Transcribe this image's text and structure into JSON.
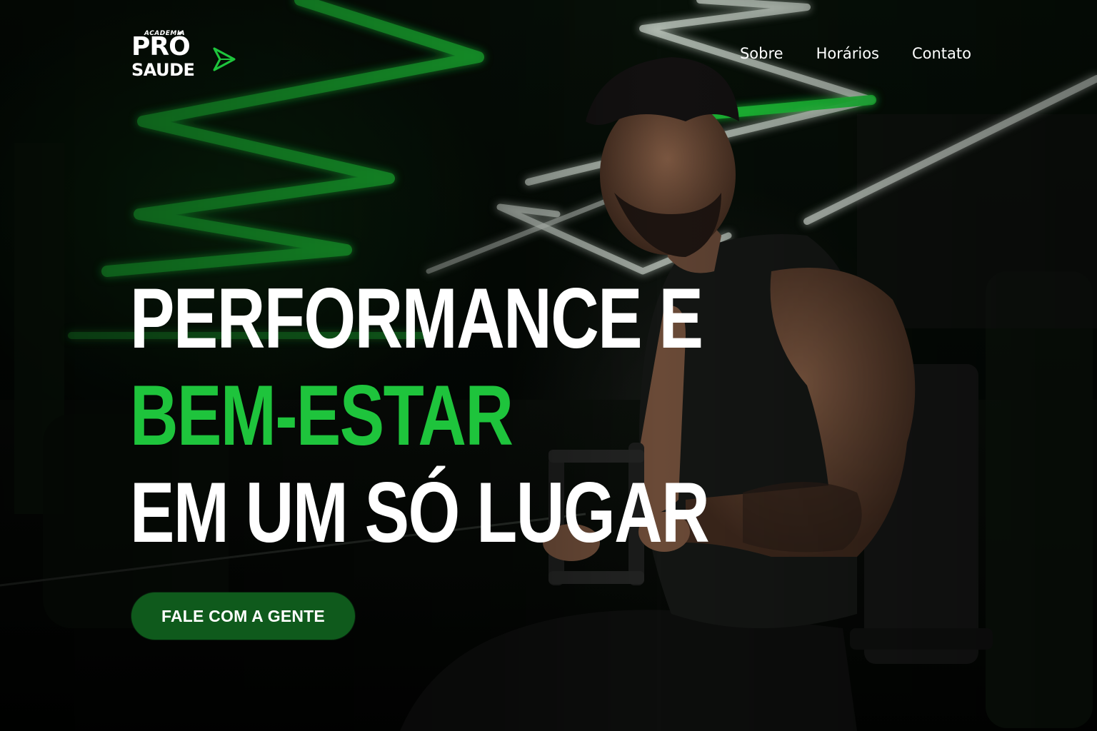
{
  "brand": {
    "small_mark": "ACADEMIA",
    "name_line1": "PRÓ",
    "name_line2": "SAUDE",
    "accent_color": "#1ec43c"
  },
  "nav": {
    "items": [
      {
        "label": "Sobre"
      },
      {
        "label": "Horários"
      },
      {
        "label": "Contato"
      }
    ]
  },
  "hero": {
    "headline_line1": "PERFORMANCE E",
    "headline_line2": "BEM-ESTAR",
    "headline_line3": "EM UM SÓ LUGAR",
    "cta_label": "FALE COM A GENTE",
    "cta_color": "#0f5a1c",
    "background_image": "gym-athlete-photo"
  }
}
